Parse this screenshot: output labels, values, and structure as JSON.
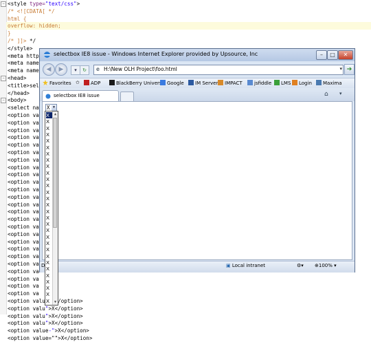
{
  "editor": {
    "lines": [
      {
        "parts": [
          {
            "t": "<style ",
            "c": "tag"
          },
          {
            "t": "type=",
            "c": "attr"
          },
          {
            "t": "\"text/css\"",
            "c": "str"
          },
          {
            "t": ">",
            "c": "tag"
          }
        ]
      },
      {
        "parts": [
          {
            "t": "/* <![CDATA[ */",
            "c": "cmt"
          }
        ]
      },
      {
        "parts": [
          {
            "t": "html {",
            "c": "cmt"
          }
        ]
      },
      {
        "parts": [
          {
            "t": "overflow: hidden;",
            "c": "cmt"
          }
        ],
        "hl": true
      },
      {
        "parts": [
          {
            "t": "}",
            "c": "cmt"
          }
        ]
      },
      {
        "parts": [
          {
            "t": "/* ]]> ",
            "c": "cmt"
          },
          {
            "t": "*/",
            "c": "tag"
          }
        ]
      },
      {
        "parts": [
          {
            "t": "</style>",
            "c": "tag"
          }
        ]
      },
      {
        "parts": [
          {
            "t": "<meta http",
            "c": "tag"
          }
        ]
      },
      {
        "parts": [
          {
            "t": "<meta name",
            "c": "tag"
          }
        ]
      },
      {
        "parts": [
          {
            "t": "<meta name",
            "c": "tag"
          }
        ]
      },
      {
        "parts": [
          {
            "t": "<head>",
            "c": "tag"
          }
        ]
      },
      {
        "parts": [
          {
            "t": "<title>sel",
            "c": "tag"
          }
        ]
      },
      {
        "parts": [
          {
            "t": "</head>",
            "c": "tag"
          }
        ]
      },
      {
        "parts": [
          {
            "t": "<body>",
            "c": "tag"
          }
        ]
      },
      {
        "parts": [
          {
            "t": "<select nam",
            "c": "tag"
          }
        ]
      },
      {
        "parts": [
          {
            "t": "<option va",
            "c": "tag"
          }
        ]
      },
      {
        "parts": [
          {
            "t": "<option va",
            "c": "tag"
          }
        ]
      },
      {
        "parts": [
          {
            "t": "<option va",
            "c": "tag"
          }
        ]
      },
      {
        "parts": [
          {
            "t": "<option va",
            "c": "tag"
          }
        ]
      },
      {
        "parts": [
          {
            "t": "<option va",
            "c": "tag"
          }
        ]
      },
      {
        "parts": [
          {
            "t": "<option va",
            "c": "tag"
          }
        ]
      },
      {
        "parts": [
          {
            "t": "<option va",
            "c": "tag"
          }
        ]
      },
      {
        "parts": [
          {
            "t": "<option va",
            "c": "tag"
          }
        ]
      },
      {
        "parts": [
          {
            "t": "<option va",
            "c": "tag"
          }
        ]
      },
      {
        "parts": [
          {
            "t": "<option va",
            "c": "tag"
          }
        ]
      },
      {
        "parts": [
          {
            "t": "<option va",
            "c": "tag"
          }
        ]
      },
      {
        "parts": [
          {
            "t": "<option va",
            "c": "tag"
          }
        ]
      },
      {
        "parts": [
          {
            "t": "<option va",
            "c": "tag"
          }
        ]
      },
      {
        "parts": [
          {
            "t": "<option va",
            "c": "tag"
          }
        ]
      },
      {
        "parts": [
          {
            "t": "<option va",
            "c": "tag"
          }
        ]
      },
      {
        "parts": [
          {
            "t": "<option va",
            "c": "tag"
          }
        ]
      },
      {
        "parts": [
          {
            "t": "<option va",
            "c": "tag"
          }
        ]
      },
      {
        "parts": [
          {
            "t": "<option va",
            "c": "tag"
          }
        ]
      },
      {
        "parts": [
          {
            "t": "<option va",
            "c": "tag"
          }
        ]
      },
      {
        "parts": [
          {
            "t": "<option va",
            "c": "tag"
          }
        ]
      },
      {
        "parts": [
          {
            "t": "<option va",
            "c": "tag"
          }
        ]
      },
      {
        "parts": [
          {
            "t": "<option va",
            "c": "tag"
          }
        ]
      },
      {
        "parts": [
          {
            "t": "<option va",
            "c": "tag"
          }
        ]
      },
      {
        "parts": [
          {
            "t": "<option va",
            "c": "tag"
          }
        ]
      },
      {
        "parts": [
          {
            "t": "<option va",
            "c": "tag"
          }
        ]
      },
      {
        "parts": [
          {
            "t": "<option valu",
            "c": "tag"
          },
          {
            "t": "\"",
            "c": "str"
          },
          {
            "t": ">X</option>",
            "c": "tag"
          }
        ]
      },
      {
        "parts": [
          {
            "t": "<option valu",
            "c": "tag"
          },
          {
            "t": "\"",
            "c": "str"
          },
          {
            "t": ">X</option>",
            "c": "tag"
          }
        ]
      },
      {
        "parts": [
          {
            "t": "<option valu",
            "c": "tag"
          },
          {
            "t": "\"",
            "c": "str"
          },
          {
            "t": ">X</option>",
            "c": "tag"
          }
        ]
      },
      {
        "parts": [
          {
            "t": "<option valu",
            "c": "tag"
          },
          {
            "t": "\"",
            "c": "str"
          },
          {
            "t": ">X</option>",
            "c": "tag"
          }
        ]
      },
      {
        "parts": [
          {
            "t": "<option value",
            "c": "tag"
          },
          {
            "t": "-\"",
            "c": "str"
          },
          {
            "t": ">X</option>",
            "c": "tag"
          }
        ]
      },
      {
        "parts": [
          {
            "t": "<option value=\"\">X</option>",
            "c": "tag"
          }
        ]
      }
    ]
  },
  "browser": {
    "title": "selectbox IE8 issue - Windows Internet Explorer provided by Upsource, Inc",
    "address": "H:\\New OLH Project\\foo.html",
    "favorites_label": "Favorites",
    "favorites": [
      "ADP",
      "BlackBerry Universe",
      "Google",
      "IM Server",
      "IMPACT",
      "jsfiddle",
      "LMS",
      "Login",
      "Maxima"
    ],
    "tab_label": "selectbox IE8 issue",
    "status_zone": "Local intranet",
    "zoom": "100%",
    "status_left": "D"
  },
  "select": {
    "value": "X",
    "options": [
      "X",
      "X",
      "X",
      "X",
      "X",
      "X",
      "X",
      "X",
      "X",
      "X",
      "X",
      "X",
      "X",
      "X",
      "X",
      "X",
      "X",
      "X",
      "X",
      "X",
      "X",
      "X",
      "X",
      "X",
      "X",
      "X",
      "X",
      "X",
      "X",
      "X"
    ],
    "selected_index": 0
  },
  "colors": {
    "selection": "#0a246a",
    "highlight_line": "#fdfbdc",
    "comment": "#c77a33",
    "attribute": "#7a1f7a",
    "string": "#2a00ff"
  }
}
